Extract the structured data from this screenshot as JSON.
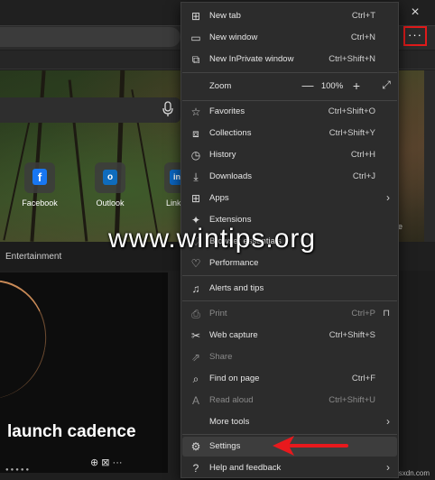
{
  "browser": {
    "close_icon": "×",
    "more_label": "···",
    "tiles": [
      {
        "label": "Facebook",
        "icon": "f",
        "color": "#1877f2"
      },
      {
        "label": "Outlook",
        "icon": "o",
        "color": "#0f6cbd"
      },
      {
        "label": "Link",
        "icon": "in",
        "color": "#0a66c2"
      }
    ],
    "hero_right_label": "d cre",
    "feed_label": "Entertainment",
    "card_title": "launch cadence",
    "card_actions": "⊕ ⊠ ···",
    "card_dots": "●●●●●",
    "watermark_bottom": "wsxdn.com"
  },
  "menu": {
    "items": [
      {
        "label": "New tab",
        "shortcut": "Ctrl+T",
        "icon": "new-tab-icon"
      },
      {
        "label": "New window",
        "shortcut": "Ctrl+N",
        "icon": "new-window-icon"
      },
      {
        "label": "New InPrivate window",
        "shortcut": "Ctrl+Shift+N",
        "icon": "inprivate-icon"
      },
      {
        "label": "Zoom",
        "shortcut": "",
        "icon": ""
      },
      {
        "label": "Favorites",
        "shortcut": "Ctrl+Shift+O",
        "icon": "favorites-icon"
      },
      {
        "label": "Collections",
        "shortcut": "Ctrl+Shift+Y",
        "icon": "collections-icon"
      },
      {
        "label": "History",
        "shortcut": "Ctrl+H",
        "icon": "history-icon"
      },
      {
        "label": "Downloads",
        "shortcut": "Ctrl+J",
        "icon": "downloads-icon"
      },
      {
        "label": "Apps",
        "shortcut": "",
        "icon": "apps-icon"
      },
      {
        "label": "Extensions",
        "shortcut": "",
        "icon": "extensions-icon"
      },
      {
        "label": "Browser essentials",
        "shortcut": "",
        "icon": "essentials-icon"
      },
      {
        "label": "Performance",
        "shortcut": "",
        "icon": "performance-icon"
      },
      {
        "label": "Alerts and tips",
        "shortcut": "",
        "icon": "bell-icon"
      },
      {
        "label": "Print",
        "shortcut": "Ctrl+P",
        "icon": "print-icon"
      },
      {
        "label": "Web capture",
        "shortcut": "Ctrl+Shift+S",
        "icon": "web-capture-icon"
      },
      {
        "label": "Share",
        "shortcut": "",
        "icon": "share-icon"
      },
      {
        "label": "Find on page",
        "shortcut": "Ctrl+F",
        "icon": "find-icon"
      },
      {
        "label": "Read aloud",
        "shortcut": "Ctrl+Shift+U",
        "icon": "read-aloud-icon"
      },
      {
        "label": "More tools",
        "shortcut": "",
        "icon": ""
      },
      {
        "label": "Settings",
        "shortcut": "",
        "icon": "gear-icon"
      },
      {
        "label": "Help and feedback",
        "shortcut": "",
        "icon": "help-icon"
      }
    ],
    "zoom": {
      "minus": "—",
      "value": "100%",
      "plus": "+",
      "fullscreen": "⤢"
    }
  },
  "watermark": "www.wintips.org",
  "colors": {
    "highlight_border": "#e01a1a",
    "arrow": "#e8191d",
    "menu_bg": "#2c2c2c"
  }
}
